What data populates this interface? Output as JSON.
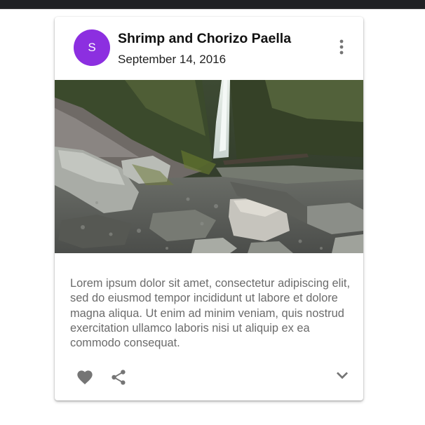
{
  "card": {
    "avatar_letter": "S",
    "title": "Shrimp and Chorizo Paella",
    "subheader": "September 14, 2016",
    "body": "Lorem ipsum dolor sit amet, consectetur adipiscing elit, sed do eiusmod tempor incididunt ut labore et dolore magna aliqua. Ut enim ad minim veniam, quis nostrud exercitation ullamco laboris nisi ut aliquip ex ea commodo consequat.",
    "icons": {
      "menu": "more-vert-icon",
      "favorite": "heart-icon",
      "share": "share-icon",
      "expand": "chevron-down-icon"
    }
  },
  "colors": {
    "avatar": "#8c2fe0",
    "icon": "#757575",
    "body_text": "#6b6b6b"
  }
}
